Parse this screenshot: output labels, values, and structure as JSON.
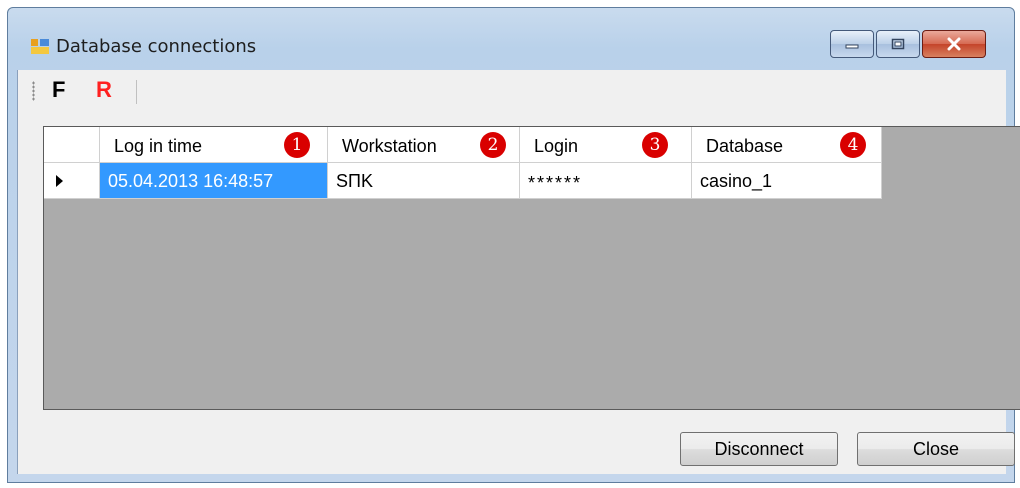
{
  "window": {
    "title": "Database connections",
    "icon": "window-app-icon",
    "controls": {
      "minimize": "minimize-icon",
      "maximize": "maximize-icon",
      "close": "close-icon"
    }
  },
  "toolbar": {
    "f_label": "F",
    "r_label": "R"
  },
  "grid": {
    "columns": [
      {
        "header": "Log in time",
        "badge": "1"
      },
      {
        "header": "Workstation",
        "badge": "2"
      },
      {
        "header": "Login",
        "badge": "3"
      },
      {
        "header": "Database",
        "badge": "4"
      }
    ],
    "rows": [
      {
        "log_in_time": "05.04.2013 16:48:57",
        "workstation": "SПK",
        "login": "******",
        "database": "casino_1"
      }
    ]
  },
  "buttons": {
    "disconnect": "Disconnect",
    "close": "Close"
  },
  "colors": {
    "selection": "#3399ff",
    "badge": "#d90000",
    "r_accent": "#ff2020"
  }
}
